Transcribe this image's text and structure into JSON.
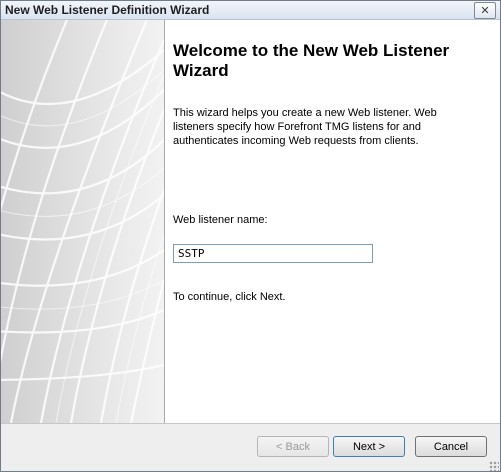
{
  "window": {
    "title": "New Web Listener Definition Wizard"
  },
  "titlebar": {
    "close_icon": "close-icon",
    "close_glyph": "✕"
  },
  "content": {
    "heading": "Welcome to the New Web Listener Wizard",
    "description": "This wizard helps you create a new Web listener. Web listeners specify how Forefront TMG listens for and authenticates incoming Web requests from clients.",
    "name_label": "Web listener name:",
    "name_value": "SSTP",
    "continue_text": "To continue, click Next."
  },
  "buttons": {
    "back": "< Back",
    "next": "Next >",
    "cancel": "Cancel"
  }
}
